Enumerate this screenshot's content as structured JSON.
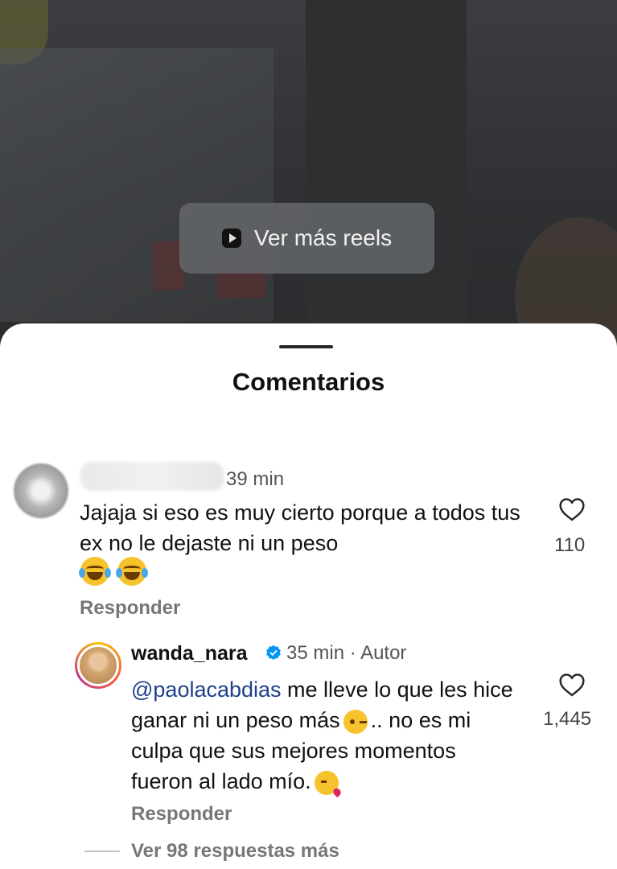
{
  "background": {
    "reels_button_label": "Ver más reels"
  },
  "sheet": {
    "title": "Comentarios"
  },
  "comments": [
    {
      "time": "39 min",
      "text": "Jajaja si eso es muy cierto porque a todos tus ex no le dejaste ni un peso",
      "emojis": [
        "face-with-tears-of-joy",
        "face-with-tears-of-joy"
      ],
      "like_count": "110",
      "reply_label": "Responder"
    }
  ],
  "reply": {
    "username": "wanda_nara",
    "time": "35 min",
    "separator": "·",
    "author_label": "Autor",
    "mention": "@paolacabdias",
    "text_part1": " me lleve lo que les hice ganar ni un peso más",
    "text_part2": ".. no es mi culpa que sus mejores momentos fueron al lado mío.",
    "emoji1": "winking-face",
    "emoji2": "face-blowing-a-kiss",
    "like_count": "1,445",
    "reply_label": "Responder",
    "more_replies_label": "Ver 98 respuestas más"
  },
  "colors": {
    "mention": "#1d3f8c",
    "verified": "#0095f6"
  }
}
